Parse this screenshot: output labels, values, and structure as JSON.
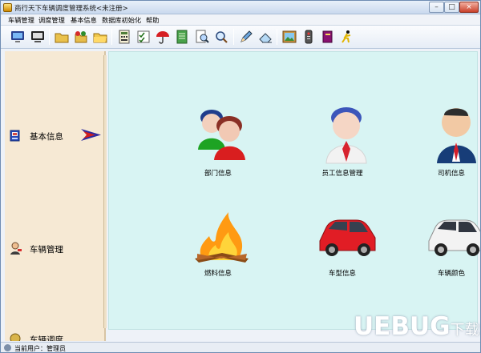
{
  "window": {
    "title": "商行天下车辆调度管理系统<未注册>",
    "controls": {
      "minimize": "–",
      "maximize": "□",
      "close": "×"
    }
  },
  "menu": [
    "车辆管理",
    "调度管理",
    "基本信息",
    "数据库初始化",
    "帮助"
  ],
  "toolbar": {
    "groups": [
      [
        "monitor-icon",
        "monitor-alt-icon"
      ],
      [
        "folder-icon",
        "network-folder-icon",
        "folder-open-icon"
      ],
      [
        "calculator-icon",
        "checklist-icon",
        "umbrella-icon",
        "notebook-icon",
        "search-document-icon",
        "magnifier-icon"
      ],
      [
        "pencil-icon",
        "eraser-icon"
      ],
      [
        "picture-icon",
        "remote-control-icon",
        "book-icon",
        "running-man-icon"
      ]
    ]
  },
  "sidebar": {
    "items": [
      {
        "label": "基本信息",
        "icon": "basic-info-icon",
        "active": true
      },
      {
        "label": "车辆管理",
        "icon": "vehicle-manage-icon",
        "active": false
      },
      {
        "label": "车辆调度",
        "icon": "dispatch-icon",
        "active": false
      }
    ]
  },
  "main": {
    "items": [
      {
        "label": "部门信息",
        "icon": "department-icon"
      },
      {
        "label": "员工信息管理",
        "icon": "employee-icon"
      },
      {
        "label": "司机信息",
        "icon": "driver-icon"
      },
      {
        "label": "燃料信息",
        "icon": "fuel-icon"
      },
      {
        "label": "车型信息",
        "icon": "car-model-icon"
      },
      {
        "label": "车辆颜色",
        "icon": "car-color-icon"
      }
    ]
  },
  "status": {
    "text": "当前用户：管理员"
  },
  "watermark": {
    "text": "UEBUG",
    "suffix": "下载站"
  },
  "colors": {
    "accent": "#d8f4f3",
    "sidebar": "#f6e9d4",
    "titlebar": "#c9d9ee"
  }
}
